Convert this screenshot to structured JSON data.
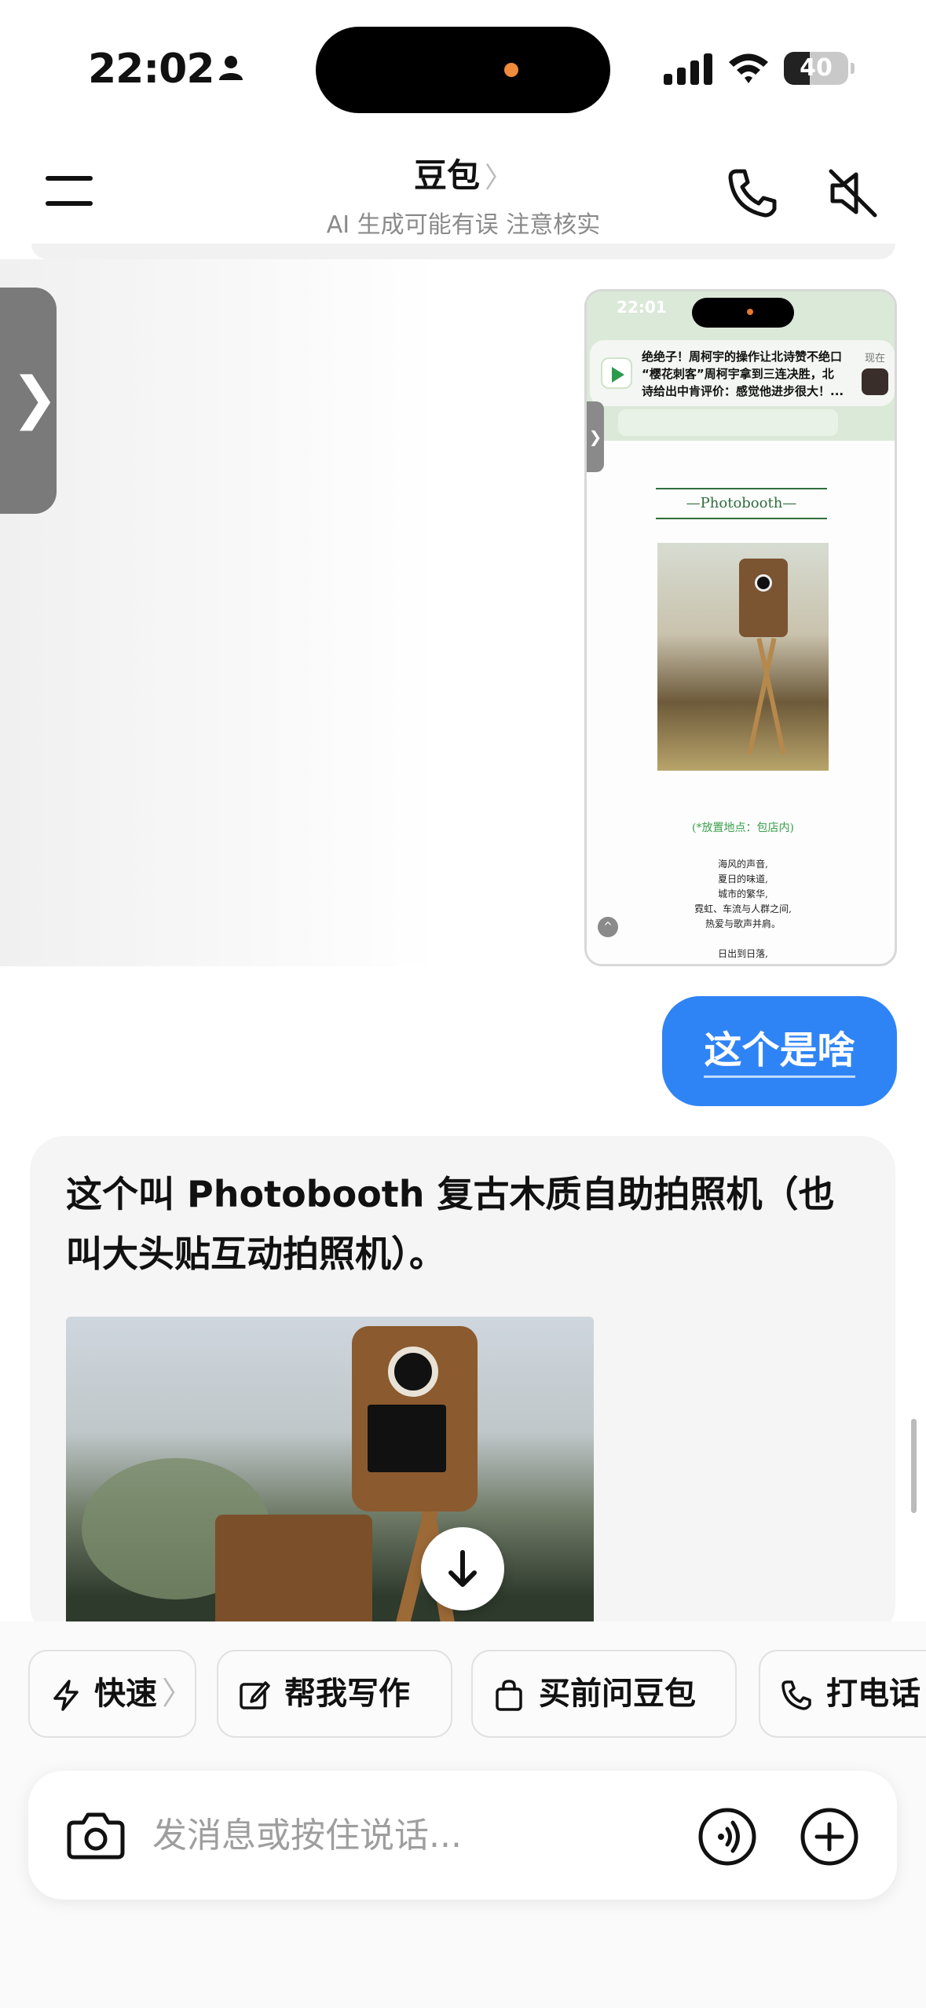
{
  "status_bar": {
    "time": "22:02",
    "battery_level": "40",
    "battery_fraction": 0.4
  },
  "header": {
    "title": "豆包",
    "title_chevron": "〉",
    "subtitle": "AI 生成可能有误 注意核实"
  },
  "side_handle": {
    "icon": "chevron-right-icon",
    "glyph": "❯"
  },
  "screenshot_thumb": {
    "time": "22:01",
    "notification": {
      "line1": "绝绝子！周柯宇的操作让北诗赞不绝口",
      "line2": "“樱花刺客”周柯宇拿到三连决胜，北",
      "line3": "诗给出中肯评价：感觉他进步很大！...",
      "when": "现在"
    },
    "banner": "—Photobooth—",
    "caption": "(*放置地点：包店内)",
    "poem": [
      "海风的声音,",
      "夏日的味道,",
      "城市的繁华,",
      "霓虹、车流与人群之间,",
      "热爱与歌声并肩。",
      "",
      "日出到日落,"
    ]
  },
  "user_message": "这个是啥",
  "ai_message": {
    "text": "这个叫 Photobooth 复古木质自助拍照机（也叫大头贴互动拍照机）。"
  },
  "quick_actions": [
    {
      "label": "快速",
      "chevron": "〉",
      "icon": "lightning-icon"
    },
    {
      "label": "帮我写作",
      "icon": "edit-icon"
    },
    {
      "label": "买前问豆包",
      "icon": "shopping-bag-icon"
    },
    {
      "label": "打电话",
      "icon": "phone-icon"
    }
  ],
  "composer": {
    "placeholder": "发消息或按住说话..."
  },
  "colors": {
    "user_bubble": "#2f84f5",
    "card_bg": "#f5f5f5",
    "accent_green": "#2f6e3e"
  }
}
